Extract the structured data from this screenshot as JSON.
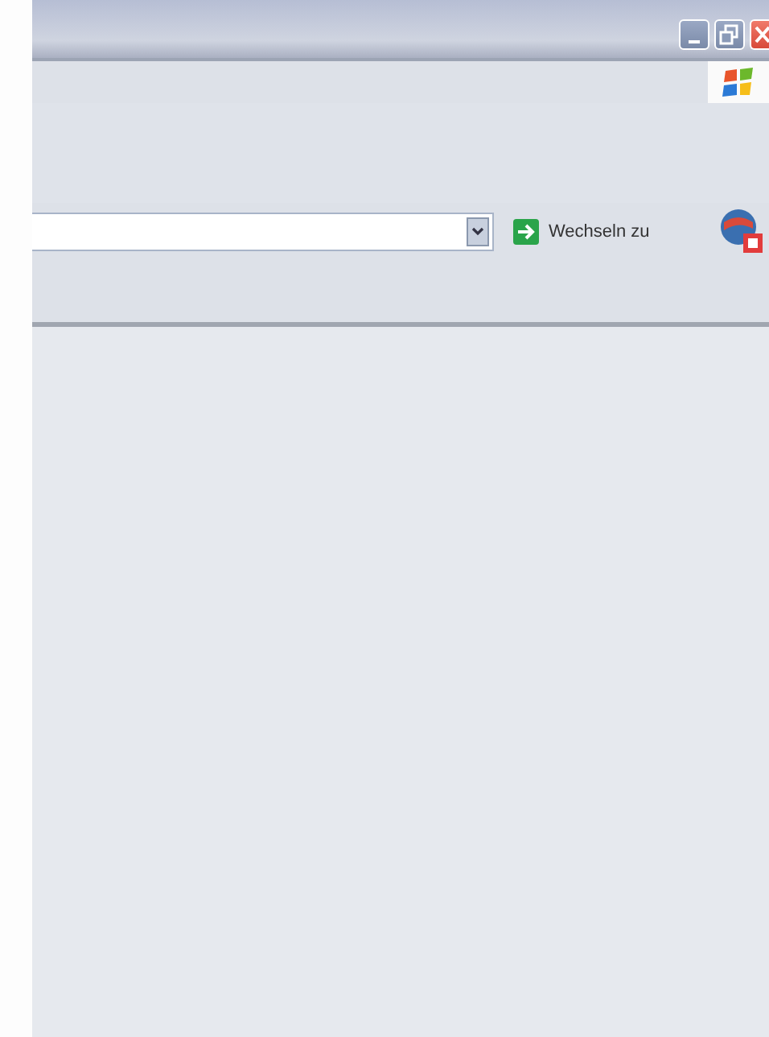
{
  "address_bar": {
    "go_label": "Wechseln zu"
  }
}
